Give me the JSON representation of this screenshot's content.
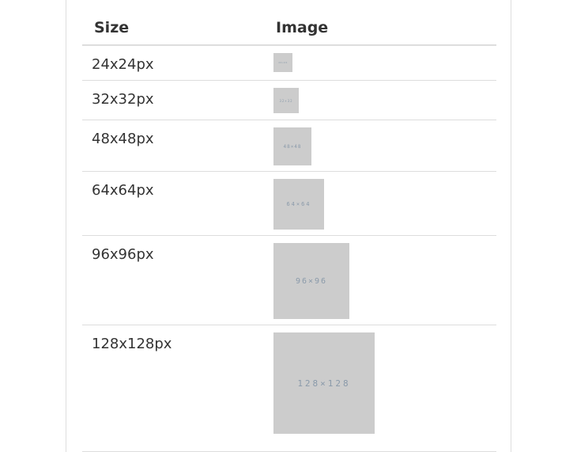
{
  "table": {
    "headers": {
      "size": "Size",
      "image": "Image"
    },
    "rows": [
      {
        "size": "24x24px",
        "placeholder_text": "24×24"
      },
      {
        "size": "32x32px",
        "placeholder_text": "32×32"
      },
      {
        "size": "48x48px",
        "placeholder_text": "48×48"
      },
      {
        "size": "64x64px",
        "placeholder_text": "64×64"
      },
      {
        "size": "96x96px",
        "placeholder_text": "96×96"
      },
      {
        "size": "128x128px",
        "placeholder_text": "128×128"
      }
    ]
  },
  "colors": {
    "placeholder_bg": "#cccccc",
    "placeholder_text": "#8a9aaa",
    "border": "#dddddd",
    "text": "#333333"
  }
}
